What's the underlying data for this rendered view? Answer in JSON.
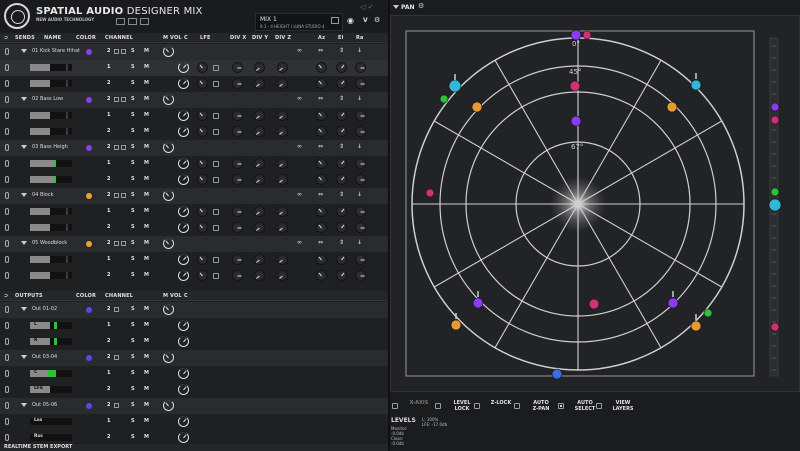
{
  "app": {
    "title_bold": "SPATIAL AUDIO",
    "title_rest": " DESIGNER",
    "title_mix": " MIX",
    "subtitle": "NEW AUDIO TECHNOLOGY"
  },
  "mix": {
    "name": "MIX 1",
    "format": "9.1 - 4 HEIGHT / LUNA STUDIO 4"
  },
  "header_v": "V",
  "sends_header": {
    "title": "SENDS",
    "name": "NAME",
    "color": "COLOR",
    "channel": "CHANNEL",
    "m": "M",
    "vol": "VOL",
    "c": "C",
    "lfe": "LFE",
    "divx": "DIV X",
    "divy": "DIV Y",
    "divz": "DIV Z",
    "az": "Az",
    "el": "El",
    "ra": "Ra"
  },
  "tracks": [
    {
      "name": "01 Kick Stare Hihat",
      "color": "#8a3df0",
      "channels": "2",
      "subs": [
        "1",
        "2"
      ]
    },
    {
      "name": "02 Bass Low",
      "color": "#8a3df0",
      "channels": "2",
      "subs": [
        "1",
        "2"
      ]
    },
    {
      "name": "03 Bass Heigh",
      "color": "#8a3df0",
      "channels": "2",
      "subs": [
        "1",
        "2"
      ]
    },
    {
      "name": "04 Block",
      "color": "#f0a030",
      "channels": "2",
      "subs": [
        "1",
        "2"
      ]
    },
    {
      "name": "05 Woodblock",
      "color": "#f0a030",
      "channels": "2",
      "subs": [
        "1",
        "2"
      ]
    }
  ],
  "outputs_header": {
    "title": "OUTPUTS",
    "color": "COLOR",
    "channel": "CHANNEL",
    "m": "M",
    "vol": "VOL",
    "c": "C"
  },
  "outputs": [
    {
      "name": "Out 01-02",
      "color": "#5a4ae0",
      "channels": "2",
      "subs": [
        {
          "label": "L",
          "ch": "1"
        },
        {
          "label": "R",
          "ch": "2"
        }
      ]
    },
    {
      "name": "Out 03-04",
      "color": "#5a4ae0",
      "channels": "2",
      "subs": [
        {
          "label": "C",
          "ch": "1"
        },
        {
          "label": "LFE",
          "ch": "2"
        }
      ]
    },
    {
      "name": "Out 05-06",
      "color": "#5a4ae0",
      "channels": "2",
      "subs": [
        {
          "label": "Lss",
          "ch": "1"
        },
        {
          "label": "Rss",
          "ch": "2"
        }
      ]
    }
  ],
  "button_labels": {
    "solo": "S",
    "mute": "M"
  },
  "realtime": "REALTIME STEM EXPORT",
  "pan": {
    "title": "PAN",
    "ring_labels": [
      "0°",
      "45°",
      "67°"
    ]
  },
  "toolbar": [
    {
      "line1": "X-AXIS",
      "line2": "",
      "state": "disabled"
    },
    {
      "line1": "LEVEL",
      "line2": "LOCK",
      "state": "off"
    },
    {
      "line1": "Z-LOCK",
      "line2": "",
      "state": "off"
    },
    {
      "line1": "AUTO",
      "line2": "Z-PAN",
      "state": "off"
    },
    {
      "line1": "AUTO",
      "line2": "SELECT",
      "state": "on"
    },
    {
      "line1": "VIEW",
      "line2": "LAYERS",
      "state": "off"
    }
  ],
  "levels": {
    "title": "LEVELS",
    "lines_left": [
      "Monitor:",
      "-0.0db",
      "Close:",
      "-0.0db"
    ],
    "lines_right": [
      "L: 100%",
      "LFE: -17.0db"
    ]
  },
  "colors": {
    "purple": "#8a3df0",
    "orange": "#e89a30",
    "magenta": "#d0307a",
    "green": "#2fbf3a",
    "cyan": "#2fb8d8",
    "blue": "#3a6ee0"
  }
}
